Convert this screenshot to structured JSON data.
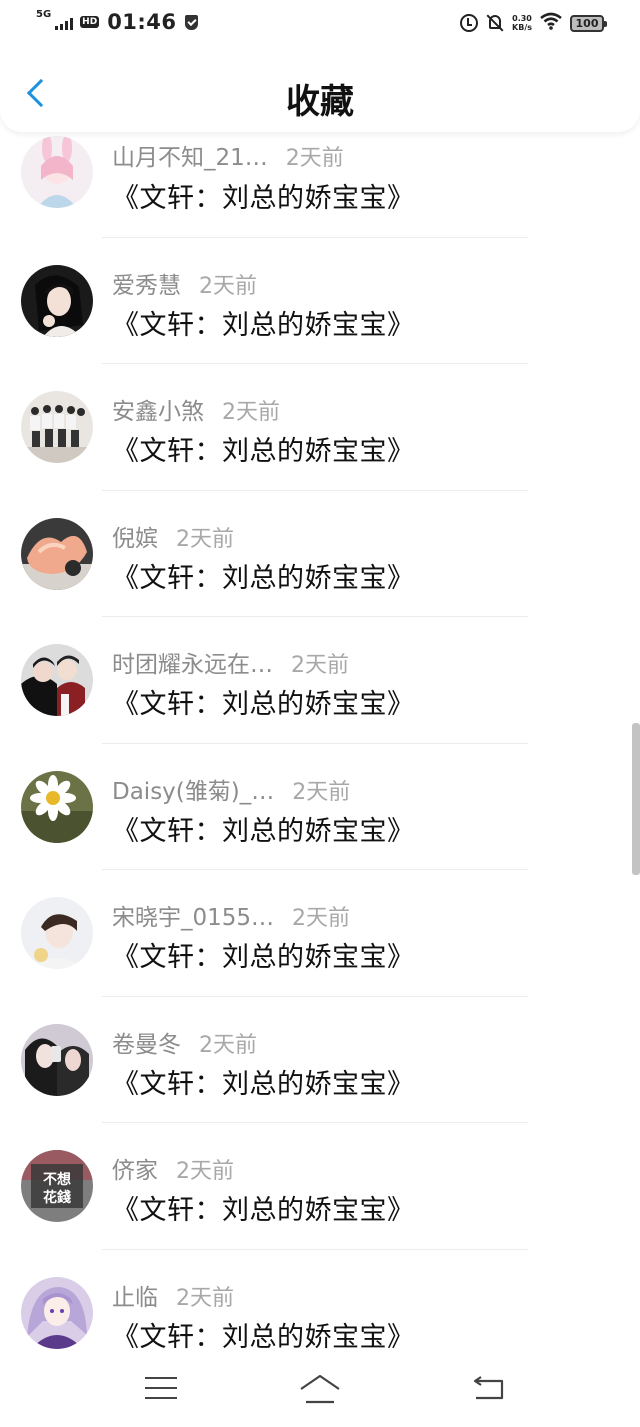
{
  "status_bar": {
    "network": "5G",
    "hd": "HD",
    "time": "01:46",
    "speed_value": "0.30",
    "speed_unit": "KB/s",
    "battery": "100"
  },
  "header": {
    "title": "收藏"
  },
  "items": [
    {
      "name": "山月不知_21…",
      "time": "2天前",
      "content": "《文轩：刘总的娇宝宝》",
      "avatar": "avatar-girl-bunny-ears"
    },
    {
      "name": "爱秀慧",
      "time": "2天前",
      "content": "《文轩：刘总的娇宝宝》",
      "avatar": "avatar-girl-portrait"
    },
    {
      "name": "安鑫小煞",
      "time": "2天前",
      "content": "《文轩：刘总的娇宝宝》",
      "avatar": "avatar-group-photo"
    },
    {
      "name": "倪嫔",
      "time": "2天前",
      "content": "《文轩：刘总的娇宝宝》",
      "avatar": "avatar-peach-dessert"
    },
    {
      "name": "时团耀永远在…",
      "time": "2天前",
      "content": "《文轩：刘总的娇宝宝》",
      "avatar": "avatar-two-boys"
    },
    {
      "name": "Daisy(雏菊)_…",
      "time": "2天前",
      "content": "《文轩：刘总的娇宝宝》",
      "avatar": "avatar-daisy-flower"
    },
    {
      "name": "宋晓宇_0155…",
      "time": "2天前",
      "content": "《文轩：刘总的娇宝宝》",
      "avatar": "avatar-boy-portrait"
    },
    {
      "name": "卷曼冬",
      "time": "2天前",
      "content": "《文轩：刘总的娇宝宝》",
      "avatar": "avatar-couple-mirror"
    },
    {
      "name": "侪家",
      "time": "2天前",
      "content": "《文轩：刘总的娇宝宝》",
      "avatar": "avatar-text-image",
      "avatar_text": "不想\n花錢"
    },
    {
      "name": "止临",
      "time": "2天前",
      "content": "《文轩：刘总的娇宝宝》",
      "avatar": "avatar-anime-girl"
    }
  ],
  "colors": {
    "accent": "#1e90e0",
    "name_text": "#8c8c8c",
    "time_text": "#a8a8a8",
    "divider": "#ececec"
  }
}
